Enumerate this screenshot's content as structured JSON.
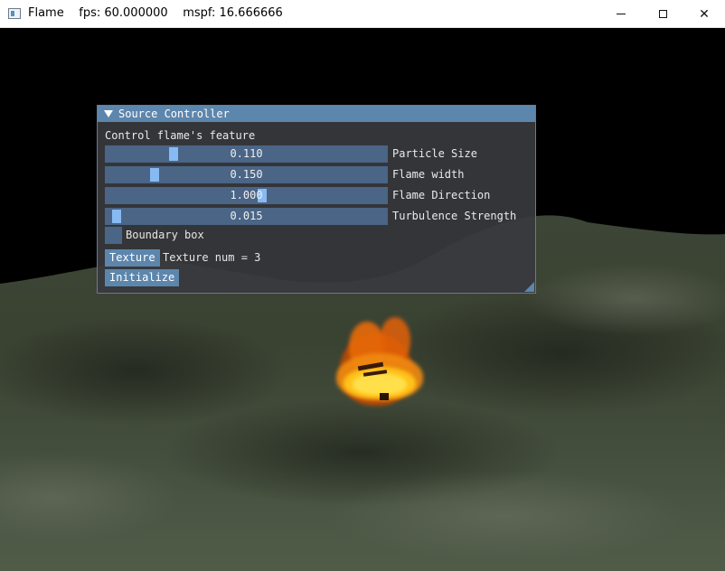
{
  "window": {
    "title": "Flame    fps: 60.000000    mspf: 16.666666",
    "icon": "window-app-icon",
    "controls": [
      "minimize-icon",
      "maximize-icon",
      "close-icon"
    ],
    "close_glyph": "✕"
  },
  "panel": {
    "title": "Source Controller",
    "description": "Control flame's feature",
    "sliders": [
      {
        "value_text": "0.110",
        "label": "Particle Size",
        "fraction": 0.23
      },
      {
        "value_text": "0.150",
        "label": "Flame width",
        "fraction": 0.16
      },
      {
        "value_text": "1.000",
        "label": "Flame Direction",
        "fraction": 0.56
      },
      {
        "value_text": "0.015",
        "label": "Turbulence Strength",
        "fraction": 0.02
      }
    ],
    "checkbox": {
      "label": "Boundary box",
      "checked": false
    },
    "texture_button": "Texture",
    "texture_info": "Texture num = 3",
    "initialize_button": "Initialize"
  },
  "colors": {
    "panel_bg": "#383a3e",
    "accent": "#5d86ad",
    "slider_bg": "#4a6586",
    "grab": "#8ec3ff"
  }
}
